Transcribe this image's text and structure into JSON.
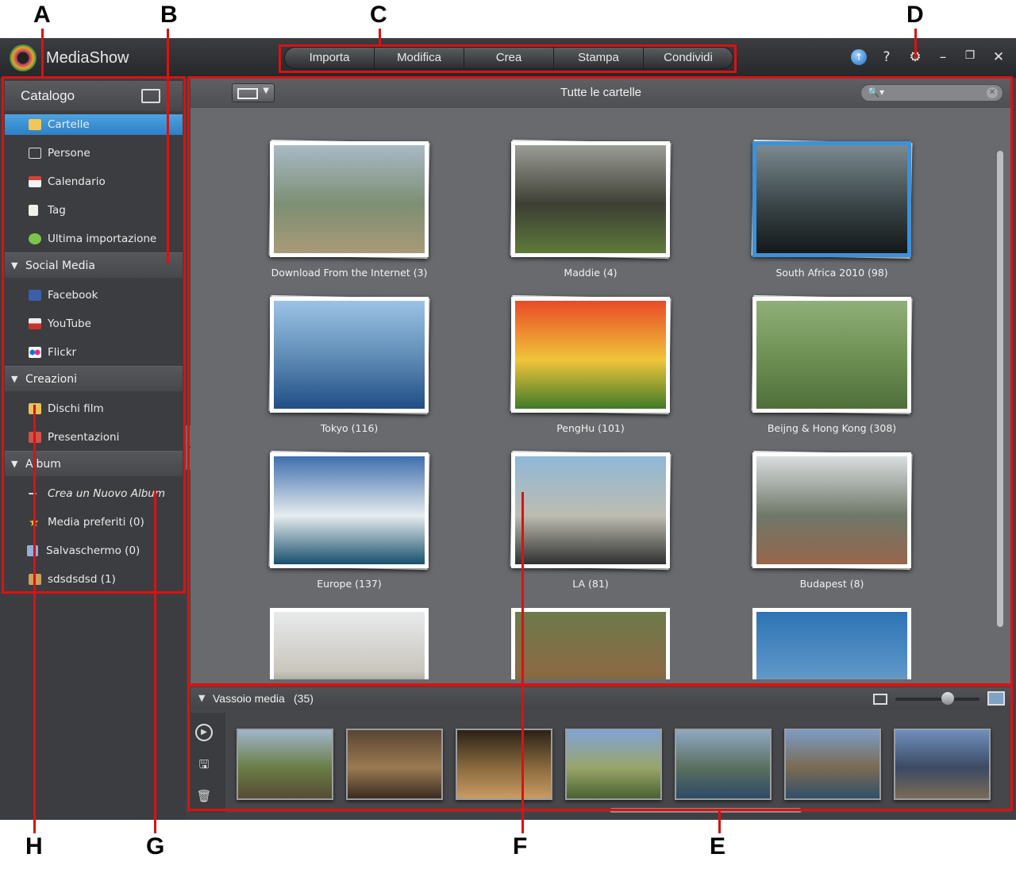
{
  "callouts": {
    "a": "A",
    "b": "B",
    "c": "C",
    "d": "D",
    "e": "E",
    "f": "F",
    "g": "G",
    "h": "H"
  },
  "app": {
    "title": "MediaShow"
  },
  "modes": [
    {
      "label": "Importa"
    },
    {
      "label": "Modifica"
    },
    {
      "label": "Crea"
    },
    {
      "label": "Stampa"
    },
    {
      "label": "Condividi"
    }
  ],
  "window_controls": {
    "upgrade": "↑",
    "help": "?",
    "settings": "⚙",
    "minimize": "–",
    "restore": "❐",
    "close": "✕"
  },
  "sidebar": {
    "title": "Catalogo",
    "library": [
      {
        "label": "Cartelle",
        "icon": "folder-icon",
        "active": true
      },
      {
        "label": "Persone",
        "icon": "people-icon"
      },
      {
        "label": "Calendario",
        "icon": "calendar-icon"
      },
      {
        "label": "Tag",
        "icon": "tag-icon"
      },
      {
        "label": "Ultima importazione",
        "icon": "import-icon"
      }
    ],
    "social_section": "Social Media",
    "social": [
      {
        "label": "Facebook",
        "icon": "facebook-icon"
      },
      {
        "label": "YouTube",
        "icon": "youtube-icon"
      },
      {
        "label": "Flickr",
        "icon": "flickr-icon"
      }
    ],
    "creations_section": "Creazioni",
    "creations": [
      {
        "label": "Dischi film",
        "icon": "disc-icon"
      },
      {
        "label": "Presentazioni",
        "icon": "slideshow-icon"
      }
    ],
    "album_section": "Album",
    "albums": [
      {
        "label": "Crea un Nuovo Album",
        "icon": "new-album-icon"
      },
      {
        "label": "Media preferiti (0)",
        "icon": "star-icon"
      },
      {
        "label": "Salvaschermo (0)",
        "icon": "screensaver-icon"
      },
      {
        "label": "sdsdsdsd (1)",
        "icon": "album-icon"
      }
    ]
  },
  "main": {
    "title": "Tutte le cartelle",
    "search_placeholder": "",
    "folders": [
      {
        "caption": "Download From the Internet (3)",
        "colors": [
          "#a8b9c6",
          "#7d8f73",
          "#a99a78"
        ]
      },
      {
        "caption": "Maddie (4)",
        "colors": [
          "#9a9c96",
          "#3d3f34",
          "#5e7a3a"
        ]
      },
      {
        "caption": "South Africa 2010 (98)",
        "colors": [
          "#7b8a8f",
          "#3a4548",
          "#141819"
        ],
        "selected": true
      },
      {
        "caption": "Tokyo (116)",
        "colors": [
          "#9cc3e6",
          "#5b88b2",
          "#204d86"
        ]
      },
      {
        "caption": "PengHu (101)",
        "colors": [
          "#e84a28",
          "#f0c53a",
          "#3f7a27"
        ]
      },
      {
        "caption": "Beijng & Hong Kong (308)",
        "colors": [
          "#8fb078",
          "#6c8e52",
          "#4f6f3a"
        ]
      },
      {
        "caption": "Europe (137)",
        "colors": [
          "#3f6fae",
          "#e6ecef",
          "#17506d"
        ]
      },
      {
        "caption": "LA (81)",
        "colors": [
          "#8fb8d8",
          "#bdbcb0",
          "#2f3130"
        ]
      },
      {
        "caption": "Budapest (8)",
        "colors": [
          "#d9dde0",
          "#6f7869",
          "#96664c"
        ]
      },
      {
        "caption": "",
        "colors": [
          "#e8eaec",
          "#c9c6bd",
          "#2f3a2a"
        ]
      },
      {
        "caption": "",
        "colors": [
          "#6d7a4b",
          "#8b6a45",
          "#4a5a33"
        ]
      },
      {
        "caption": "",
        "colors": [
          "#2d74b5",
          "#5b94c7",
          "#9fb3a8"
        ]
      }
    ]
  },
  "tray": {
    "title": "Vassoio media",
    "count": "(35)",
    "buttons": {
      "play": "▶",
      "save": "🖫",
      "delete": "🗑"
    },
    "thumbs": [
      {
        "colors": [
          "#9fb6c9",
          "#6a7d46",
          "#574b33"
        ]
      },
      {
        "colors": [
          "#5a4532",
          "#9a7a52",
          "#3b2c20"
        ]
      },
      {
        "colors": [
          "#2b2118",
          "#8a6a3e",
          "#c99b62"
        ]
      },
      {
        "colors": [
          "#7fa4d6",
          "#9aa56a",
          "#4a6230"
        ]
      },
      {
        "colors": [
          "#8fa8c2",
          "#5a6f5e",
          "#2e4a66"
        ]
      },
      {
        "colors": [
          "#7c9cc4",
          "#7a6b52",
          "#2f4f6a"
        ]
      },
      {
        "colors": [
          "#6f8fbd",
          "#3c4a63",
          "#7a6a56"
        ]
      }
    ]
  }
}
